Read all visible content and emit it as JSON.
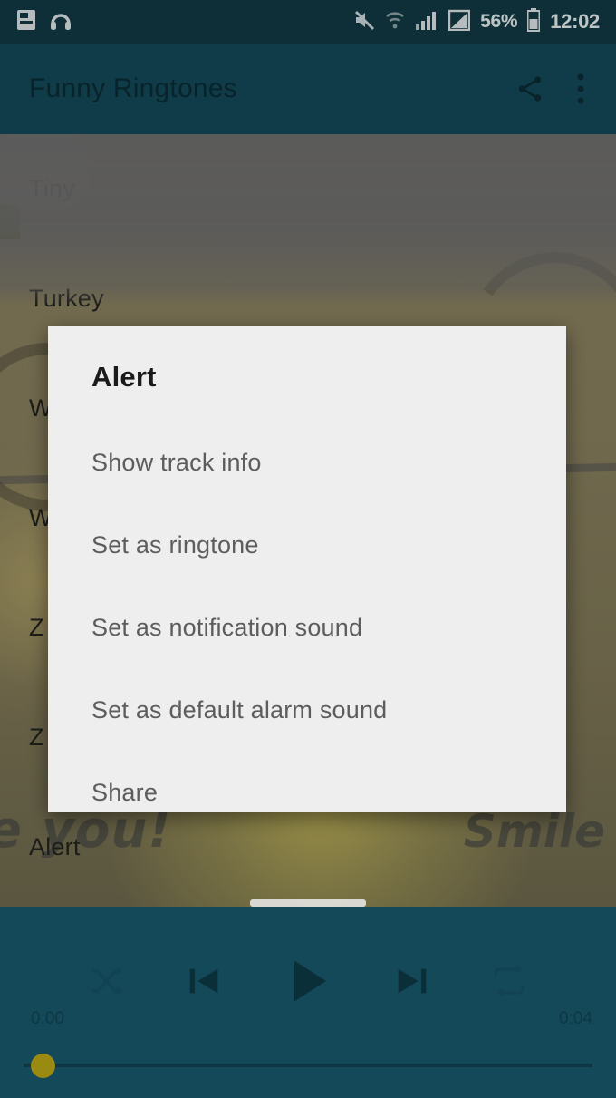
{
  "status_bar": {
    "left_icons": [
      "sd-card-icon",
      "headphones-icon"
    ],
    "right_icons": [
      "mute-icon",
      "wifi-icon",
      "signal-bars-icon",
      "signal-strength-icon",
      "battery-icon"
    ],
    "battery_percent": "56%",
    "clock": "12:02",
    "background_color": "#123a44"
  },
  "app_bar": {
    "title": "Funny Ringtones",
    "share_icon": "share-icon",
    "overflow_icon": "more-vertical-icon",
    "background_color": "#14495a",
    "title_color": "#0c2b34"
  },
  "track_list": {
    "items": [
      {
        "label": "Tiny"
      },
      {
        "label": "Turkey"
      },
      {
        "label": "W"
      },
      {
        "label": "W"
      },
      {
        "label": "Z"
      },
      {
        "label": "Z"
      },
      {
        "label": "Alert"
      }
    ]
  },
  "dialog": {
    "title": "Alert",
    "background_color": "#eeeeee",
    "items": [
      {
        "label": "Show track info"
      },
      {
        "label": "Set as ringtone"
      },
      {
        "label": "Set as notification sound"
      },
      {
        "label": "Set as default alarm sound"
      },
      {
        "label": "Share"
      }
    ]
  },
  "player": {
    "background_color": "#14495a",
    "time_current": "0:00",
    "time_total": "0:04",
    "seek_position_percent": 0,
    "controls": [
      {
        "name": "shuffle-icon",
        "dim": true
      },
      {
        "name": "previous-track-icon",
        "dim": false
      },
      {
        "name": "play-icon",
        "dim": false
      },
      {
        "name": "next-track-icon",
        "dim": false
      },
      {
        "name": "repeat-icon",
        "dim": true
      }
    ],
    "seek_thumb_color": "#9b8a12"
  },
  "wallpaper": {
    "doodle_text_left": "e you!",
    "doodle_text_right": "Smile",
    "base_color": "#8a8160"
  }
}
